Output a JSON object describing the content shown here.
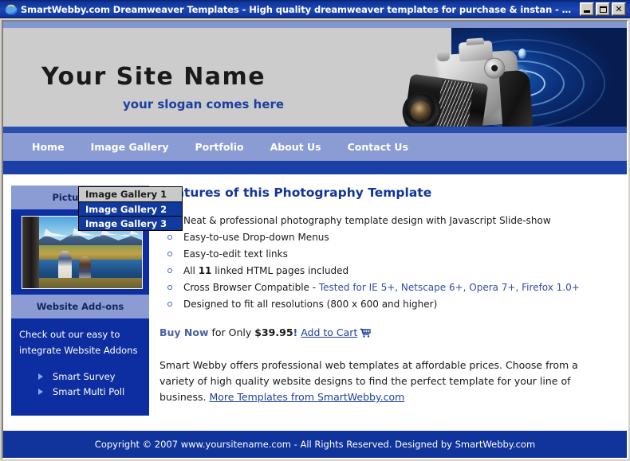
{
  "window": {
    "title": "SmartWebby.com Dreamweaver Templates - High quality dreamweaver templates for purchase & instan - Windows Interne...",
    "icon": "internet-explorer-icon",
    "buttons": {
      "minimize": "minimize-icon",
      "maximize": "maximize-icon",
      "close": "close-icon"
    }
  },
  "banner": {
    "site_name": "Your Site Name",
    "slogan": "your slogan comes here",
    "graphic": "camera-and-water-droplet-image"
  },
  "nav": {
    "items": [
      {
        "label": "Home"
      },
      {
        "label": "Image Gallery"
      },
      {
        "label": "Portfolio"
      },
      {
        "label": "About Us"
      },
      {
        "label": "Contact Us"
      }
    ]
  },
  "dropdown": {
    "open_for": "Image Gallery",
    "items": [
      {
        "label": "Image Gallery 1",
        "state": "hovered"
      },
      {
        "label": "Image Gallery 2",
        "state": "normal"
      },
      {
        "label": "Image Gallery 3",
        "state": "normal"
      }
    ]
  },
  "sidebar": {
    "pictures_heading": "Pictures of",
    "photo_alt": "anglers-fly-fishing-river-mountains-photo",
    "addons_heading": "Website Add-ons",
    "addons_text": "Check out our easy to integrate Website Addons",
    "addons_links": [
      {
        "label": "Smart Survey"
      },
      {
        "label": "Smart Multi Poll"
      }
    ]
  },
  "main": {
    "heading": "Features of this Photography Template",
    "features": [
      {
        "text": "Neat & professional photography template design with Javascript Slide-show"
      },
      {
        "text": "Easy-to-use Drop-down Menus"
      },
      {
        "text": "Easy-to-edit text links"
      },
      {
        "text": "All 11 linked HTML pages included",
        "bold_part": "11"
      },
      {
        "text": "Cross Browser Compatible - Tested for IE 5+, Netscape 6+, Opera 7+, Firefox 1.0+",
        "plain_part": "Cross Browser Compatible - ",
        "blue_part": "Tested for IE 5+, Netscape 6+, Opera 7+, Firefox 1.0+"
      },
      {
        "text": "Designed to fit all resolutions (800 x 600 and higher)"
      }
    ],
    "buy": {
      "buy_now_label": "Buy Now",
      "for_only_label": " for Only ",
      "price": "$39.95",
      "exclamation": "!",
      "add_to_cart_label": "Add to Cart",
      "cart_icon": "shopping-cart-icon"
    },
    "paragraph": {
      "part1": "Smart Webby offers professional web templates at affordable prices. Choose from a variety of high quality website designs to find the perfect template for your line of business. ",
      "link": "More Templates from SmartWebby.com"
    }
  },
  "footer": {
    "text": "Copyright © 2007 www.yoursitename.com - All Rights Reserved. Designed by SmartWebby.com"
  },
  "colors": {
    "title_bar": "#0a246a",
    "nav_bar": "#8b9bd4",
    "deep_blue": "#10349b",
    "banner_gray": "#cccccc",
    "heading_blue": "#12349b",
    "dropdown_blue": "#103a9e",
    "dropdown_hover": "#c9c9c9"
  }
}
